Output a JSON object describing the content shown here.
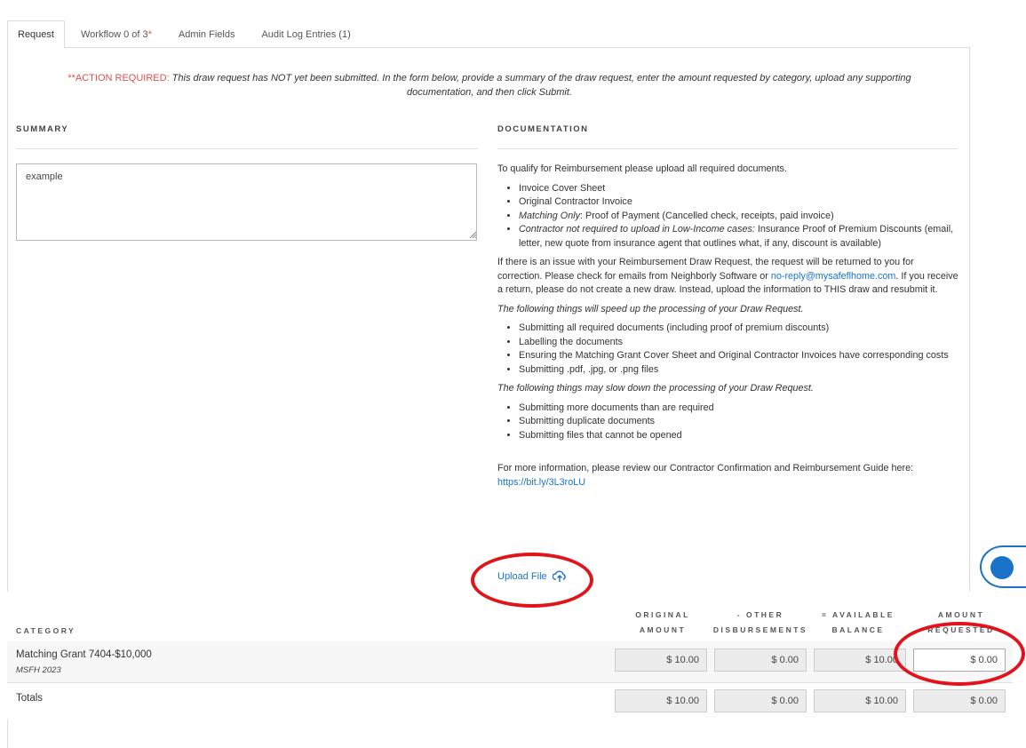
{
  "tabs": [
    {
      "label": "Request",
      "active": true
    },
    {
      "label": "Workflow 0 of 3",
      "star": "*"
    },
    {
      "label": "Admin Fields"
    },
    {
      "label": "Audit Log Entries (1)"
    }
  ],
  "action": {
    "prefix": "**ACTION REQUIRED:",
    "message": " This draw request has NOT yet been submitted.  In the form below, provide a summary of the draw request, enter the amount requested by category, upload any supporting documentation, and then click Submit."
  },
  "summary": {
    "heading": "SUMMARY",
    "value": "example"
  },
  "documentation": {
    "heading": "DOCUMENTATION",
    "intro": "To qualify for Reimbursement please upload all required documents.",
    "required": [
      {
        "label": "",
        "text": "Invoice Cover Sheet"
      },
      {
        "label": "",
        "text": "Original Contractor Invoice"
      },
      {
        "label": "Matching Only",
        "text": ": Proof of Payment (Cancelled check, receipts, paid invoice)"
      },
      {
        "label": "Contractor not required to upload in Low-Income cases:",
        "text": " Insurance Proof of Premium Discounts (email, letter, new quote from insurance agent that outlines what, if any, discount is available)"
      }
    ],
    "issue_before": "If there is an issue with your Reimbursement Draw Request, the request will be returned to you for correction. Please check for emails from Neighborly Software or ",
    "issue_email": "no-reply@mysafeflhome.com",
    "issue_after": ". If you receive a return, please do not create a new draw. Instead, upload the information to THIS draw and resubmit it.",
    "speed_title": "The following things will speed up the processing of your Draw Request.",
    "speed_items": [
      "Submitting all required documents (including proof of premium discounts)",
      "Labelling the documents",
      "Ensuring the Matching Grant Cover Sheet and Original Contractor Invoices have corresponding costs",
      "Submitting .pdf, .jpg, or .png files"
    ],
    "slow_title": "The following things may slow down the processing of your Draw Request.",
    "slow_items": [
      " Submitting more documents than are required",
      "Submitting duplicate documents",
      "Submitting files that cannot be opened"
    ],
    "more_info": "For more information, please review our Contractor Confirmation and Reimbursement Guide here:",
    "more_link": "https://bit.ly/3L3roLU"
  },
  "upload": {
    "label": "Upload File"
  },
  "grid": {
    "headers": {
      "category": "CATEGORY",
      "original": [
        "ORIGINAL",
        "AMOUNT"
      ],
      "other": [
        "- OTHER",
        "DISBURSEMENTS"
      ],
      "available": [
        "= AVAILABLE",
        "BALANCE"
      ],
      "requested": [
        "AMOUNT",
        "REQUESTED"
      ]
    },
    "row": {
      "name": "Matching Grant 7404-$10,000",
      "sub": "MSFH 2023",
      "original": "$ 10.00",
      "other": "$ 0.00",
      "available": "$ 10.00",
      "requested": "$ 0.00"
    },
    "totals": {
      "label": "Totals",
      "original": "$ 10.00",
      "other": "$ 0.00",
      "available": "$ 10.00",
      "requested": "$ 0.00"
    }
  },
  "annotation": {
    "color": "#e0141a"
  },
  "icons": {
    "upload": "cloud-upload-icon",
    "help": "help-icon"
  }
}
